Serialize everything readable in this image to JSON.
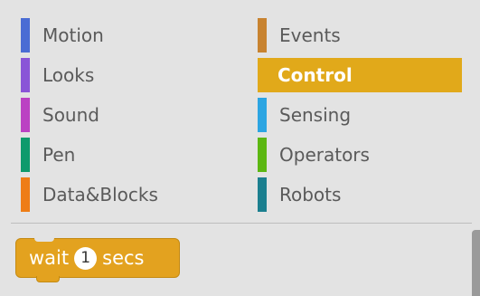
{
  "categories": {
    "left": [
      {
        "label": "Motion",
        "color": "#4a6cd4"
      },
      {
        "label": "Looks",
        "color": "#8a55d7"
      },
      {
        "label": "Sound",
        "color": "#bb42c3"
      },
      {
        "label": "Pen",
        "color": "#0e9a6c"
      },
      {
        "label": "Data&Blocks",
        "color": "#ee7d16"
      }
    ],
    "right": [
      {
        "label": "Events",
        "color": "#c88330"
      },
      {
        "label": "Control",
        "color": "#e1a91a",
        "selected": true
      },
      {
        "label": "Sensing",
        "color": "#2ca5e2"
      },
      {
        "label": "Operators",
        "color": "#5cb712"
      },
      {
        "label": "Robots",
        "color": "#1b7f8f"
      }
    ]
  },
  "block": {
    "word1": "wait",
    "arg": "1",
    "word2": "secs",
    "color": "#e3a21f"
  }
}
